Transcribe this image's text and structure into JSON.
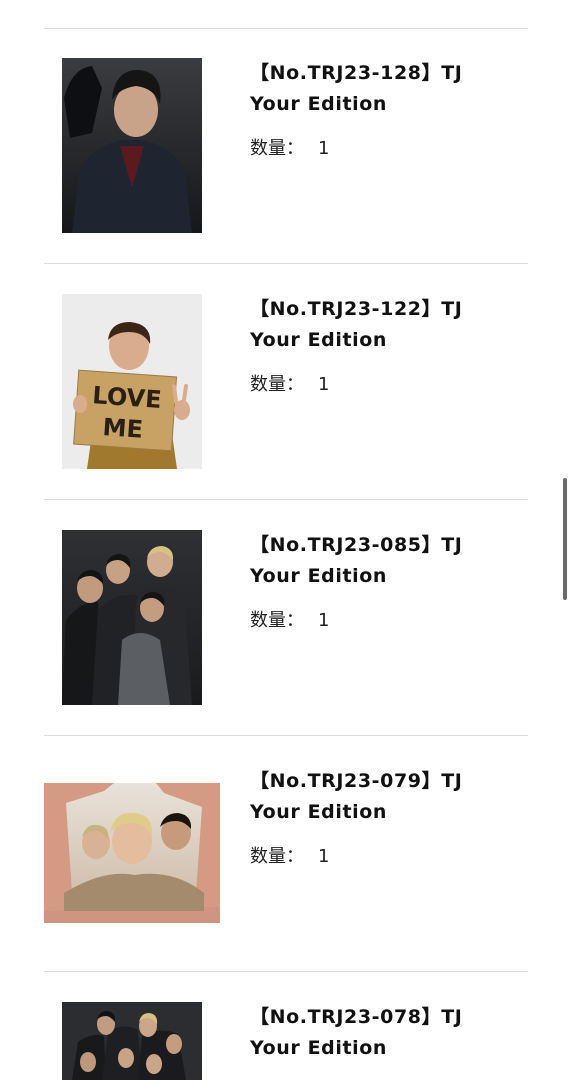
{
  "cart": {
    "items": [
      {
        "title_line1": "【No.TRJ23-128】TJ",
        "title_line2": "Your Edition",
        "quantity_label": "数量：",
        "quantity": "1",
        "image_icon": "photo-single-dark"
      },
      {
        "title_line1": "【No.TRJ23-122】TJ",
        "title_line2": "Your Edition",
        "quantity_label": "数量：",
        "quantity": "1",
        "image_icon": "photo-love-me-sign",
        "sign_line1": "LOVE",
        "sign_line2": "ME"
      },
      {
        "title_line1": "【No.TRJ23-085】TJ",
        "title_line2": "Your Edition",
        "quantity_label": "数量：",
        "quantity": "1",
        "image_icon": "photo-group-dark"
      },
      {
        "title_line1": "【No.TRJ23-079】TJ",
        "title_line2": "Your Edition",
        "quantity_label": "数量：",
        "quantity": "1",
        "image_icon": "photo-group-landscape"
      },
      {
        "title_line1": "【No.TRJ23-078】TJ",
        "title_line2": "Your Edition",
        "image_icon": "photo-group-partial"
      }
    ]
  },
  "colors": {
    "divider": "#dcdcdc",
    "text": "#111111",
    "scrollbar": "#6b6b6b"
  }
}
